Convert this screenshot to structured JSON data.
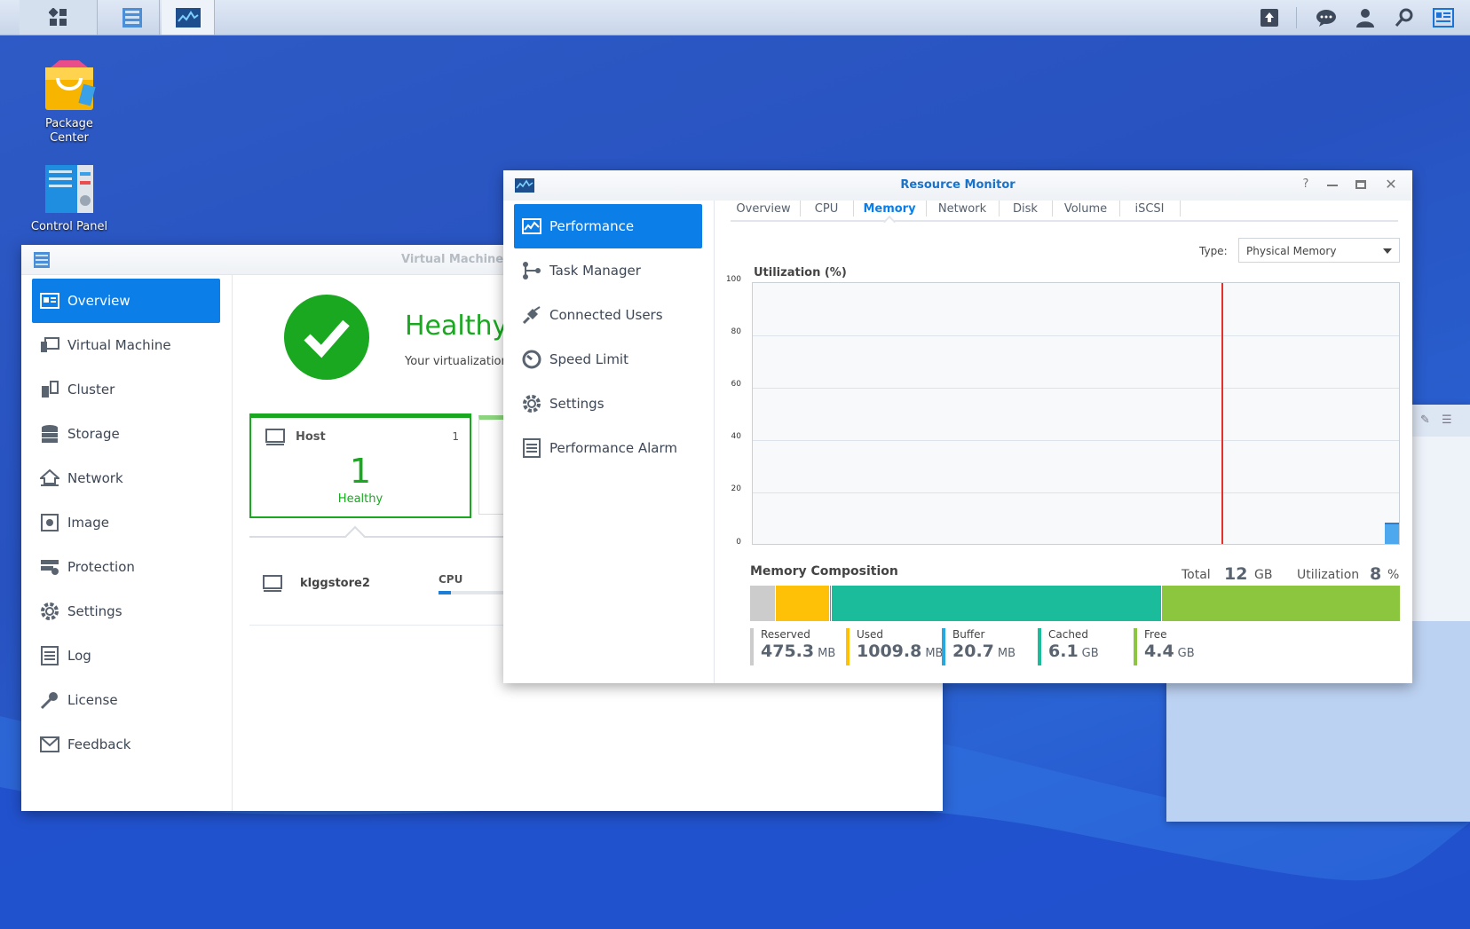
{
  "desktop": {
    "icons": [
      {
        "label_line1": "Package",
        "label_line2": "Center"
      },
      {
        "label_line1": "Control Panel",
        "label_line2": ""
      }
    ]
  },
  "vmm": {
    "title": "Virtual Machine",
    "nav": [
      {
        "label": "Overview",
        "icon": "overview-icon"
      },
      {
        "label": "Virtual Machine",
        "icon": "virtual-machine-icon"
      },
      {
        "label": "Cluster",
        "icon": "cluster-icon"
      },
      {
        "label": "Storage",
        "icon": "storage-icon"
      },
      {
        "label": "Network",
        "icon": "network-icon"
      },
      {
        "label": "Image",
        "icon": "image-icon"
      },
      {
        "label": "Protection",
        "icon": "protection-icon"
      },
      {
        "label": "Settings",
        "icon": "settings-icon"
      },
      {
        "label": "Log",
        "icon": "log-icon"
      },
      {
        "label": "License",
        "icon": "license-icon"
      },
      {
        "label": "Feedback",
        "icon": "feedback-icon"
      }
    ],
    "status_title": "Healthy",
    "status_desc": "Your virtualization",
    "host_card": {
      "label": "Host",
      "count": "1",
      "big_number": "1",
      "state": "Healthy"
    },
    "host_row": {
      "name": "klggstore2",
      "cpu_label": "CPU",
      "cpu_fraction": 0.15
    }
  },
  "rm": {
    "title": "Resource Monitor",
    "nav": [
      {
        "label": "Performance",
        "icon": "performance-icon"
      },
      {
        "label": "Task Manager",
        "icon": "task-manager-icon"
      },
      {
        "label": "Connected Users",
        "icon": "connected-users-icon"
      },
      {
        "label": "Speed Limit",
        "icon": "speed-limit-icon"
      },
      {
        "label": "Settings",
        "icon": "settings-icon"
      },
      {
        "label": "Performance Alarm",
        "icon": "performance-alarm-icon"
      }
    ],
    "tabs": [
      "Overview",
      "CPU",
      "Memory",
      "Network",
      "Disk",
      "Volume",
      "iSCSI"
    ],
    "selected_tab": "Memory",
    "type_label": "Type:",
    "type_value": "Physical Memory",
    "chart_title": "Utilization (%)",
    "composition_title": "Memory Composition",
    "total_label": "Total",
    "total_value": "12",
    "total_unit": "GB",
    "util_label": "Utilization",
    "util_value": "8",
    "util_unit": "%",
    "legend": [
      {
        "label": "Reserved",
        "value": "475.3",
        "unit": "MB",
        "color": "#cccccc"
      },
      {
        "label": "Used",
        "value": "1009.8",
        "unit": "MB",
        "color": "#ffc107"
      },
      {
        "label": "Buffer",
        "value": "20.7",
        "unit": "MB",
        "color": "#29a8e0"
      },
      {
        "label": "Cached",
        "value": "6.1",
        "unit": "GB",
        "color": "#1abc9c"
      },
      {
        "label": "Free",
        "value": "4.4",
        "unit": "GB",
        "color": "#8cc63f"
      }
    ]
  },
  "chart_data": {
    "type": "area",
    "title": "Utilization (%)",
    "ylim": [
      0,
      100
    ],
    "yticks": [
      0,
      20,
      40,
      60,
      80,
      100
    ],
    "series": [
      {
        "values": [
          8
        ]
      }
    ],
    "composition": {
      "type": "bar",
      "categories": [
        "Reserved",
        "Used",
        "Buffer",
        "Cached",
        "Free"
      ],
      "values_mb": [
        475.3,
        1009.8,
        20.7,
        6246.4,
        4505.6
      ],
      "colors": [
        "#cccccc",
        "#ffc107",
        "#29a8e0",
        "#1abc9c",
        "#8cc63f"
      ]
    }
  }
}
